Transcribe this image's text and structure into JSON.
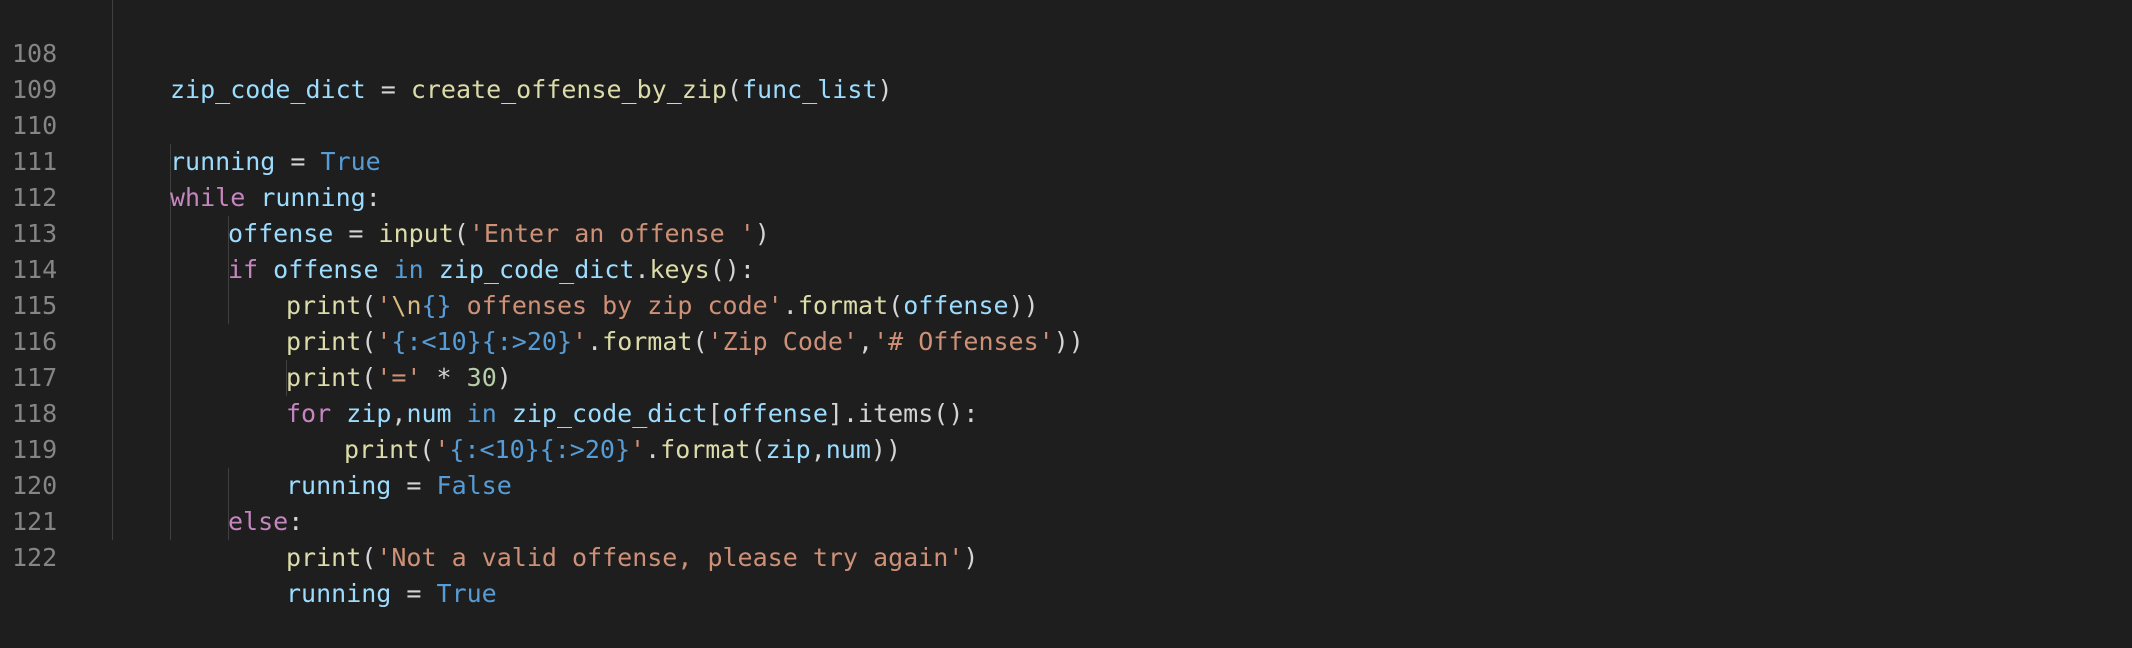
{
  "editor": {
    "language": "python",
    "theme_colors": {
      "background": "#1e1e1e",
      "line_number": "#858585",
      "variable": "#9cdcfe",
      "function": "#dcdcaa",
      "keyword": "#c586c0",
      "constant": "#569cd6",
      "string": "#ce9178",
      "number": "#b5cea8"
    },
    "lines": [
      {
        "number": "108",
        "tokens": [
          "zip_code_dict",
          " = ",
          "create_offense_by_zip",
          "(",
          "func_list",
          ")"
        ]
      },
      {
        "number": "109",
        "tokens": []
      },
      {
        "number": "110",
        "tokens": [
          "running",
          " = ",
          "True"
        ]
      },
      {
        "number": "111",
        "tokens": [
          "while",
          " ",
          "running",
          ":"
        ]
      },
      {
        "number": "112",
        "tokens": [
          "offense",
          " = ",
          "input",
          "(",
          "'Enter an offense '",
          ")"
        ]
      },
      {
        "number": "113",
        "tokens": [
          "if",
          " ",
          "offense",
          " ",
          "in",
          " ",
          "zip_code_dict",
          ".",
          "keys",
          "():"
        ]
      },
      {
        "number": "114",
        "tokens": [
          "print",
          "(",
          "'",
          "\\n",
          "{}",
          " offenses by zip code'",
          ".",
          "format",
          "(",
          "offense",
          "))"
        ]
      },
      {
        "number": "115",
        "tokens": [
          "print",
          "(",
          "'",
          "{:<10}{:>20}",
          "'",
          ".",
          "format",
          "(",
          "'Zip Code'",
          ",",
          "'# Offenses'",
          "))"
        ]
      },
      {
        "number": "116",
        "tokens": [
          "print",
          "(",
          "'='",
          " * ",
          "30",
          ")"
        ]
      },
      {
        "number": "117",
        "tokens": [
          "for",
          " ",
          "zip",
          ",",
          "num",
          " ",
          "in",
          " ",
          "zip_code_dict",
          "[",
          "offense",
          "].items():"
        ]
      },
      {
        "number": "118",
        "tokens": [
          "print",
          "(",
          "'",
          "{:<10}{:>20}",
          "'",
          ".",
          "format",
          "(",
          "zip",
          ",",
          "num",
          "))"
        ]
      },
      {
        "number": "119",
        "tokens": [
          "running",
          " = ",
          "False"
        ]
      },
      {
        "number": "120",
        "tokens": [
          "else",
          ":"
        ]
      },
      {
        "number": "121",
        "tokens": [
          "print",
          "(",
          "'Not a valid offense, please try again'",
          ")"
        ]
      },
      {
        "number": "122",
        "tokens": [
          "running",
          " = ",
          "True"
        ]
      }
    ]
  }
}
